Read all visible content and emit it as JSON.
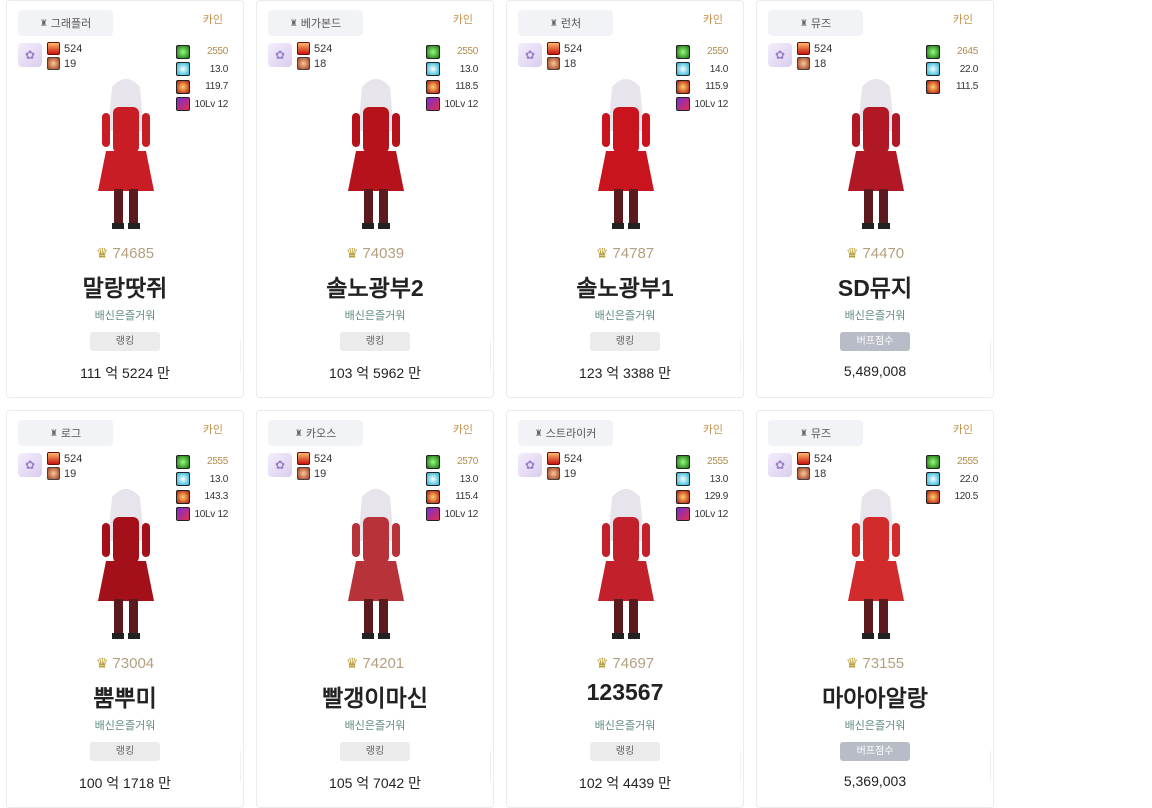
{
  "icons": {
    "job": "crown-icon",
    "avatar": "avatar-icon",
    "fame": "fame-icon",
    "pet": "pet-icon",
    "score_medal": "medal-icon"
  },
  "cards": [
    {
      "job": "그래플러",
      "server": "카인",
      "fame": "524",
      "level": "19",
      "stats": [
        "2550",
        "13.0",
        "119.7",
        "10Lv 12"
      ],
      "adventure_score": "74685",
      "name": "말랑땃쥐",
      "guild": "배신은즐거워",
      "tag": "랭킹",
      "tag_type": "rank",
      "power": "111 억 5224 만",
      "color": "#c81d25"
    },
    {
      "job": "베가본드",
      "server": "카인",
      "fame": "524",
      "level": "18",
      "stats": [
        "2550",
        "13.0",
        "118.5",
        "10Lv 12"
      ],
      "adventure_score": "74039",
      "name": "솔노광부2",
      "guild": "배신은즐거워",
      "tag": "랭킹",
      "tag_type": "rank",
      "power": "103 억 5962 만",
      "color": "#b5121b"
    },
    {
      "job": "런처",
      "server": "카인",
      "fame": "524",
      "level": "18",
      "stats": [
        "2550",
        "14.0",
        "115.9",
        "10Lv 12"
      ],
      "adventure_score": "74787",
      "name": "솔노광부1",
      "guild": "배신은즐거워",
      "tag": "랭킹",
      "tag_type": "rank",
      "power": "123 억 3388 만",
      "color": "#c9141d"
    },
    {
      "job": "뮤즈",
      "server": "카인",
      "fame": "524",
      "level": "18",
      "stats": [
        "2645",
        "22.0",
        "111.5"
      ],
      "adventure_score": "74470",
      "name": "SD뮤지",
      "guild": "배신은즐거워",
      "tag": "버프점수",
      "tag_type": "buff",
      "power": "5,489,008",
      "color": "#b01826"
    },
    {
      "job": "로그",
      "server": "카인",
      "fame": "524",
      "level": "19",
      "stats": [
        "2555",
        "13.0",
        "143.3",
        "10Lv 12"
      ],
      "adventure_score": "73004",
      "name": "뿜뿌미",
      "guild": "배신은즐거워",
      "tag": "랭킹",
      "tag_type": "rank",
      "power": "100 억 1718 만",
      "color": "#a3101a"
    },
    {
      "job": "카오스",
      "server": "카인",
      "fame": "524",
      "level": "19",
      "stats": [
        "2570",
        "13.0",
        "115.4",
        "10Lv 12"
      ],
      "adventure_score": "74201",
      "name": "빨갱이마신",
      "guild": "배신은즐거워",
      "tag": "랭킹",
      "tag_type": "rank",
      "power": "105 억 7042 만",
      "color": "#b8323a"
    },
    {
      "job": "스트라이커",
      "server": "카인",
      "fame": "524",
      "level": "19",
      "stats": [
        "2555",
        "13.0",
        "129.9",
        "10Lv 12"
      ],
      "adventure_score": "74697",
      "name": "123567",
      "guild": "배신은즐거워",
      "tag": "랭킹",
      "tag_type": "rank",
      "power": "102 억 4439 만",
      "color": "#c2202a"
    },
    {
      "job": "뮤즈",
      "server": "카인",
      "fame": "524",
      "level": "18",
      "stats": [
        "2555",
        "22.0",
        "120.5"
      ],
      "adventure_score": "73155",
      "name": "마아아알랑",
      "guild": "배신은즐거워",
      "tag": "버프점수",
      "tag_type": "buff",
      "power": "5,369,003",
      "color": "#d12b2b"
    }
  ]
}
